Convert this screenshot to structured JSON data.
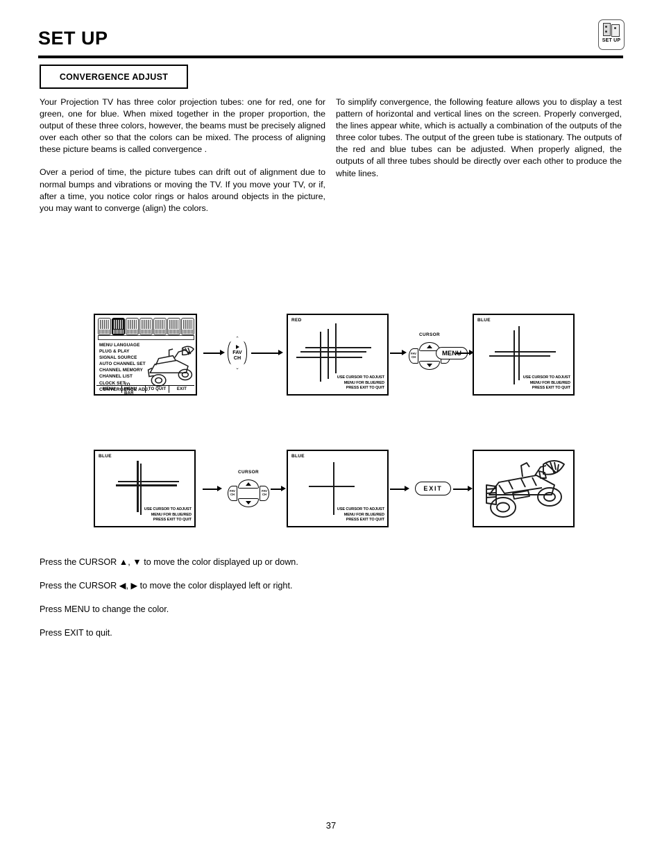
{
  "header": {
    "title": "SET UP",
    "badge_label": "SET UP",
    "badge_icon": "setup-panel-icon"
  },
  "section": {
    "label": "CONVERGENCE ADJUST"
  },
  "body": {
    "left_paragraphs": [
      "Your Projection TV has three color projection tubes: one for red, one for green, one for blue. When mixed together in the proper proportion, the output of these three colors, however, the beams must be precisely aligned over each other so that the colors can be mixed. The process of aligning these picture beams is called  convergence .",
      "Over a period of time, the picture tubes can drift out of alignment due to normal bumps and vibrations or moving the TV. If you move your TV, or if, after a time, you notice color rings or halos around objects in the picture, you may want to converge (align) the colors."
    ],
    "right_paragraphs": [
      "To simplify convergence, the following feature allows you to display a test pattern of horizontal and vertical lines on the screen. Properly converged, the lines appear white, which is actually a combination of the outputs of the three color tubes. The output of the green tube is stationary. The outputs of the red and blue tubes can be adjusted. When properly aligned, the outputs of all three tubes should be directly over each other to produce the white lines."
    ]
  },
  "osd_menu": {
    "items": [
      "MENU LANGUAGE",
      "PLUG & PLAY",
      "SIGNAL SOURCE",
      "AUTO CHANNEL SET",
      "CHANNEL MEMORY",
      "CHANNEL LIST",
      "CLOCK SET"
    ],
    "selected_item": "CONVERGENCE ADJ.",
    "bottom_bar": [
      "MENU",
      "TO MENU BAR",
      "TO QUIT",
      "EXIT"
    ],
    "icon_count": 7,
    "selected_icon_index": 1
  },
  "screens": {
    "red_tag": "RED",
    "blue_tag": "BLUE",
    "note_lines": [
      "USE CURSOR TO ADJUST",
      "MENU FOR BLUE/RED",
      "PRESS EXIT TO QUIT"
    ]
  },
  "controls": {
    "favch_line1": "FAV",
    "favch_line2": "CH",
    "cursor_label": "CURSOR",
    "cursor_side_line1": "FAV",
    "cursor_side_line2": "CH",
    "menu_button": "MENU",
    "exit_button": "EXIT"
  },
  "instructions": [
    "Press the  CURSOR ▲, ▼ to move the color displayed up or down.",
    "Press the CURSOR ◀, ▶ to move the color displayed left or right.",
    "Press MENU to change the color.",
    "Press EXIT to quit."
  ],
  "footer": {
    "page_number": "37"
  }
}
